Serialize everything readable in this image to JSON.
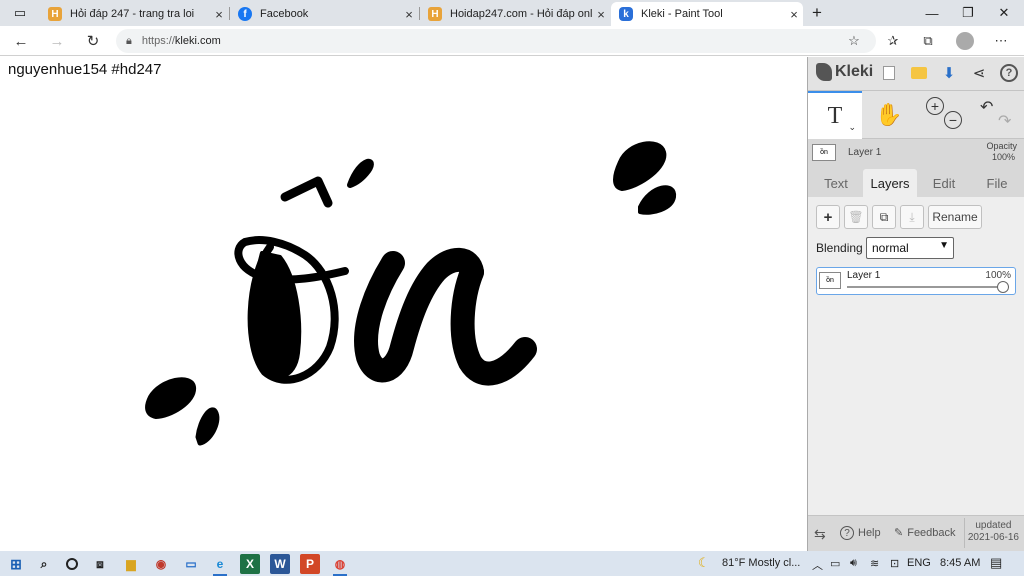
{
  "browser": {
    "tabs": [
      {
        "title": "Hỏi đáp 247 - trang tra loi",
        "favicon": "hoidap-h-icon",
        "close": "×"
      },
      {
        "title": "Facebook",
        "favicon": "facebook-icon",
        "close": "×"
      },
      {
        "title": "Hoidap247.com - Hỏi đáp online",
        "favicon": "hoidap-h-icon",
        "close": "×"
      },
      {
        "title": "Kleki - Paint Tool",
        "favicon": "kleki-icon",
        "close": "×"
      }
    ],
    "new_tab": "+",
    "window_controls": {
      "minimize": "—",
      "maximize": "❐",
      "close": "✕"
    },
    "address": {
      "prefix": "https://",
      "host": "kleki.com"
    },
    "nav": {
      "back": "←",
      "forward": "→",
      "reload": "↻"
    }
  },
  "canvas": {
    "caption": "nguyenhue154 #hd247"
  },
  "kleki": {
    "logo": "Kleki",
    "tools": {
      "text_tool": "T",
      "hand_tool": "✋",
      "zoom_in": "+",
      "zoom_out": "−",
      "undo": "↶",
      "redo": "↷"
    },
    "layer_info": {
      "name": "Layer 1",
      "opacity_label": "Opacity",
      "opacity_value": "100%"
    },
    "tabs": [
      "Text",
      "Layers",
      "Edit",
      "File"
    ],
    "active_tab": "Layers",
    "layer_buttons": {
      "add": "+",
      "rename": "Rename"
    },
    "blending": {
      "label": "Blending",
      "value": "normal"
    },
    "layers": [
      {
        "name": "Layer 1",
        "opacity": "100%",
        "opacity_fraction": 1.0
      }
    ],
    "footer": {
      "help": "Help",
      "feedback": "Feedback",
      "updated_label": "updated",
      "updated_date": "2021-06-16"
    }
  },
  "taskbar": {
    "weather": "81°F  Mostly cl...",
    "lang": "ENG",
    "time": "8:45 AM"
  },
  "colors": {
    "accent": "#3b8eea",
    "taskbar": "#dbe4ef",
    "sidebar": "#d8d8d8"
  }
}
